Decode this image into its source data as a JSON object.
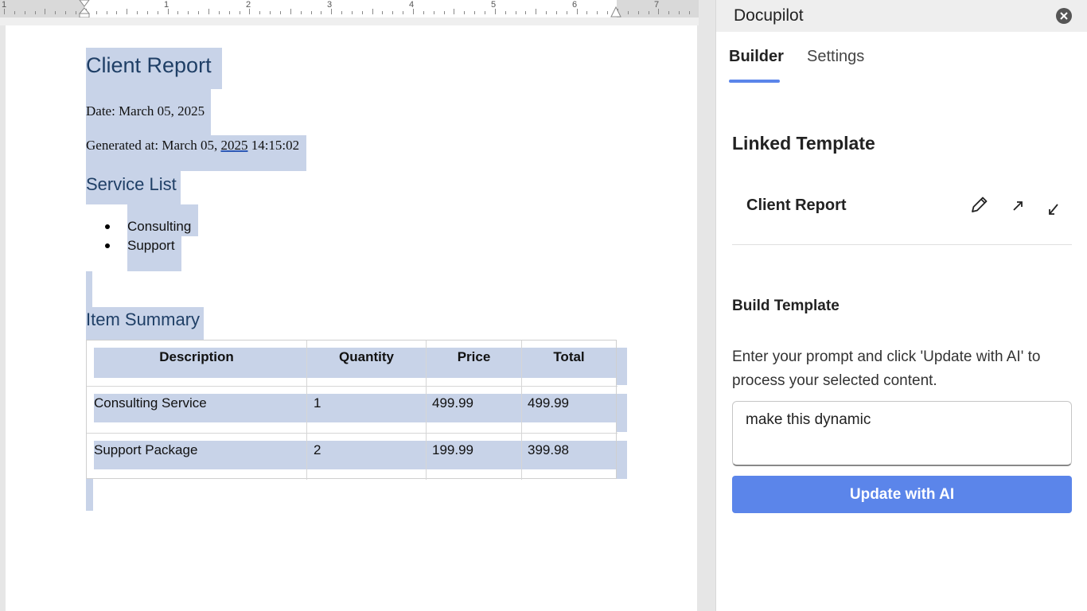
{
  "ruler": {
    "numbers": [
      "1",
      "1",
      "2",
      "3",
      "4",
      "5",
      "6",
      "7"
    ]
  },
  "document": {
    "title": "Client Report",
    "date_line": "Date: March 05, 2025",
    "generated_prefix": "Generated at: March 05, ",
    "generated_year": "2025",
    "generated_time": " 14:15:02",
    "service_heading": "Service List",
    "services": [
      "Consulting",
      "Support"
    ],
    "summary_heading": "Item Summary",
    "table": {
      "headers": [
        "Description",
        "Quantity",
        "Price",
        "Total"
      ],
      "rows": [
        [
          "Consulting Service",
          "1",
          "499.99",
          "499.99"
        ],
        [
          "Support Package",
          "2",
          "199.99",
          "399.98"
        ]
      ]
    }
  },
  "panel": {
    "app_title": "Docupilot",
    "tabs": [
      "Builder",
      "Settings"
    ],
    "active_tab": "Builder",
    "linked_heading": "Linked Template",
    "linked_template_name": "Client Report",
    "build_heading": "Build Template",
    "build_description": "Enter your prompt and click 'Update with AI' to process your selected content.",
    "prompt_value": "make this dynamic",
    "update_button": "Update with AI"
  },
  "colors": {
    "accent": "#5b85ea",
    "selection": "#c8d3e8",
    "heading": "#1f3f66"
  },
  "icons": [
    "close-icon",
    "pencil-icon",
    "open-external-icon",
    "import-icon"
  ]
}
